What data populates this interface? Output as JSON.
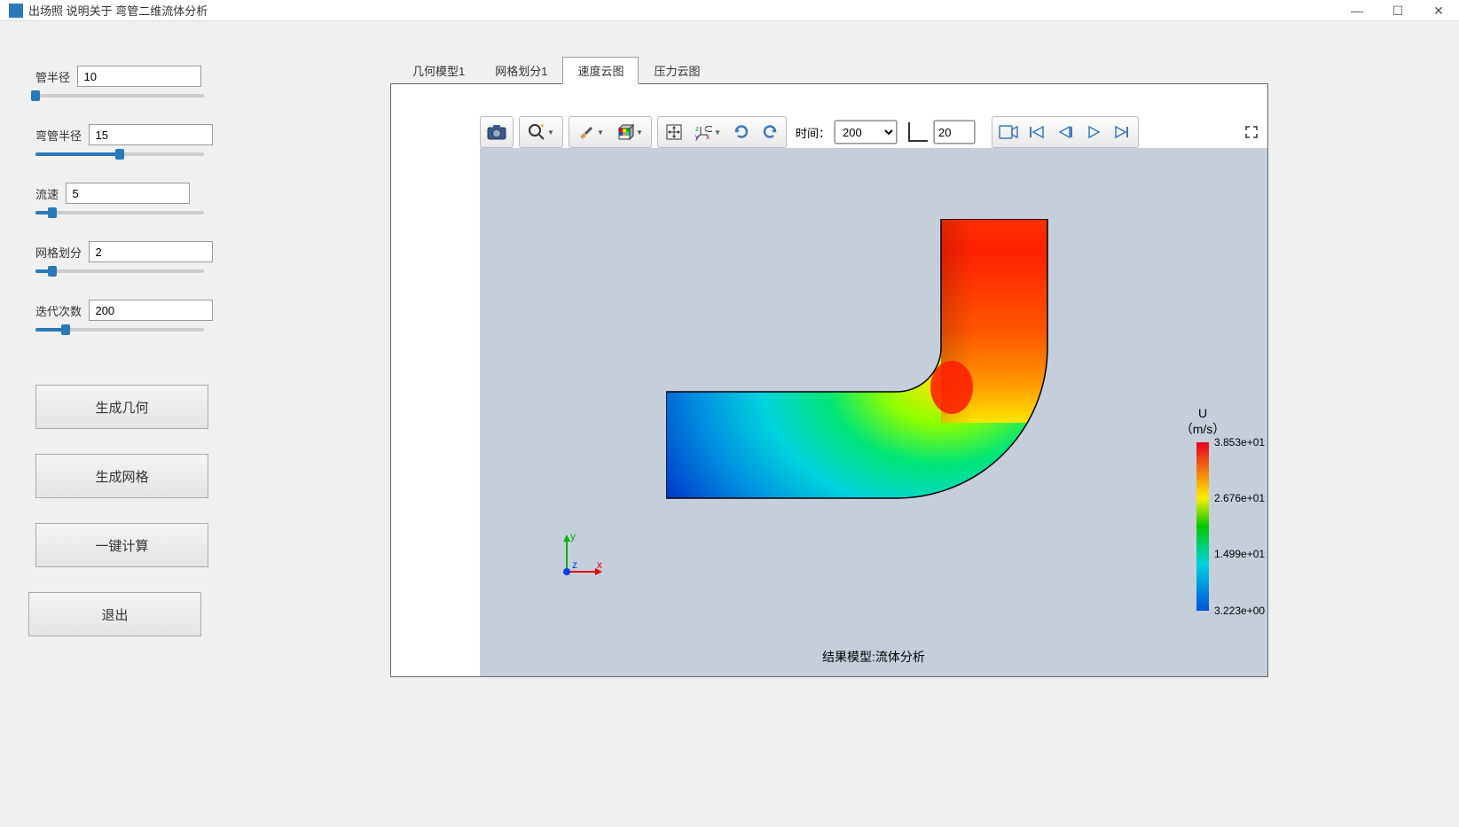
{
  "titlebar": {
    "text": "出场照 说明关于 弯管二维流体分析"
  },
  "params": [
    {
      "label": "管半径",
      "value": "10",
      "slider_pct": 0
    },
    {
      "label": "弯管半径",
      "value": "15",
      "slider_pct": 50
    },
    {
      "label": "流速",
      "value": "5",
      "slider_pct": 10
    },
    {
      "label": "网格划分",
      "value": "2",
      "slider_pct": 10
    },
    {
      "label": "迭代次数",
      "value": "200",
      "slider_pct": 18
    }
  ],
  "buttons": {
    "gen_geom": "生成几何",
    "gen_mesh": "生成网格",
    "one_calc": "一键计算",
    "exit": "退出"
  },
  "tabs": [
    {
      "label": "几何模型1",
      "active": false
    },
    {
      "label": "网格划分1",
      "active": false
    },
    {
      "label": "速度云图",
      "active": true
    },
    {
      "label": "压力云图",
      "active": false
    }
  ],
  "toolbar": {
    "time_label": "时间：",
    "time_value": "200",
    "spin_value": "20"
  },
  "result_caption": "结果模型:流体分析",
  "legend": {
    "title_1": "U",
    "title_2": "（m/s）",
    "ticks": [
      "3.853e+01",
      "2.676e+01",
      "1.499e+01",
      "3.223e+00"
    ]
  },
  "axis": {
    "x": "x",
    "y": "y",
    "z": "z"
  },
  "chart_data": {
    "type": "heatmap",
    "title": "速度云图 U (m/s)",
    "quantity": "Velocity magnitude U",
    "unit": "m/s",
    "range": [
      3.223,
      38.53
    ],
    "colormap": "rainbow",
    "legend_ticks": [
      3.223,
      14.99,
      26.76,
      38.53
    ],
    "geometry": "2D L-shaped elbow pipe",
    "description": "High velocity (red ~38 m/s) at top vertical inlet decreasing through bend; low velocity (blue ~3 m/s) along bottom-left horizontal outlet; yellow/green transition zone through inner radius of bend."
  }
}
